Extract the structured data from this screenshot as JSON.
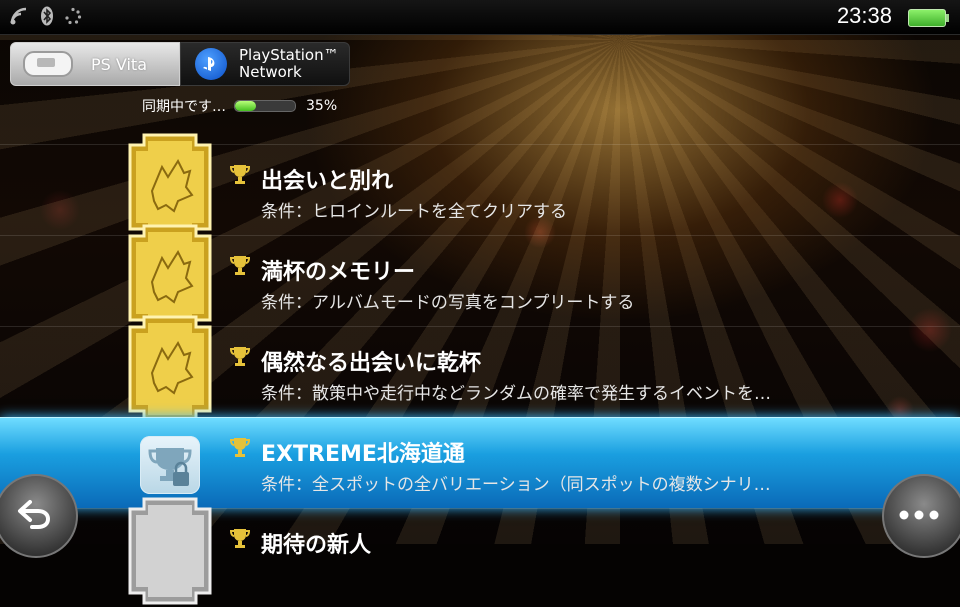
{
  "status": {
    "time": "23:38",
    "icons": [
      "wifi-icon",
      "bluetooth-icon",
      "loading-icon"
    ],
    "battery_color": "#4fd037"
  },
  "tabs": [
    {
      "id": "ps-vita",
      "label": "PS Vita",
      "active": true,
      "icon": "ps-vita-icon"
    },
    {
      "id": "psn",
      "label_line1": "PlayStation™",
      "label_line2": "Network",
      "active": false,
      "icon": "playstation-network-icon"
    }
  ],
  "sync": {
    "label": "同期中です…",
    "percent_text": "35%",
    "progress": 0.35
  },
  "trophies": [
    {
      "title": "出会いと別れ",
      "condition": "条件：ヒロインルートを全てクリアする",
      "grade": "gold",
      "unlocked": true
    },
    {
      "title": "満杯のメモリー",
      "condition": "条件：アルバムモードの写真をコンプリートする",
      "grade": "gold",
      "unlocked": true
    },
    {
      "title": "偶然なる出会いに乾杯",
      "condition": "条件：散策中や走行中などランダムの確率で発生するイベントを…",
      "grade": "gold",
      "unlocked": true
    },
    {
      "title": "EXTREME北海道通",
      "condition": "条件：全スポットの全バリエーション（同スポットの複数シナリ…",
      "grade": "gold",
      "unlocked": false,
      "selected": true
    },
    {
      "title": "期待の新人",
      "condition": "",
      "grade": "silver",
      "unlocked": true
    }
  ],
  "buttons": {
    "back": "back-arrow-icon",
    "more": "more-options-icon"
  },
  "colors": {
    "selection": "#1a9fe0",
    "gold": "#e6c23a",
    "silver": "#cfcfcf"
  }
}
